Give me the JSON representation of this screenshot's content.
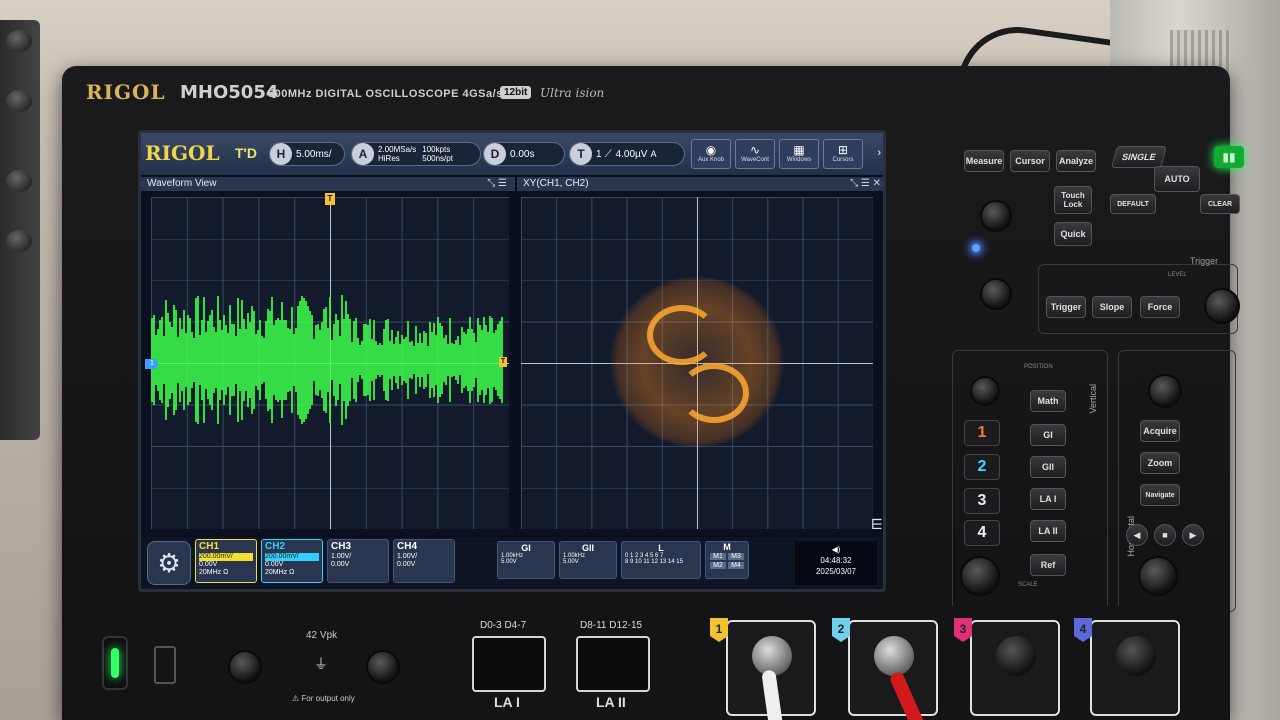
{
  "device": {
    "brand": "RIGOL",
    "model": "MHO5054",
    "spec": "500MHz DIGITAL OSCILLOSCOPE 4GSa/s",
    "bits": "12bit",
    "ultra": "Ultra ision"
  },
  "screen": {
    "logo": "RIGOL",
    "mode": "T'D",
    "horizontal": {
      "badge": "H",
      "value": "5.00ms/"
    },
    "acquire": {
      "badge": "A",
      "rate": "2.00MSa/s",
      "mode": "HiRes",
      "points": "100kpts",
      "per_div": "500ns/pt"
    },
    "delay": {
      "badge": "D",
      "value": "0.00s"
    },
    "trigger": {
      "badge": "T",
      "channel": "1",
      "level": "4.00µV",
      "suffix": "A"
    },
    "toolbar": [
      {
        "icon": "knob-icon",
        "label": "Aux Knob"
      },
      {
        "icon": "wave-icon",
        "label": "WaveCont"
      },
      {
        "icon": "window-icon",
        "label": "Windows"
      },
      {
        "icon": "cursor-icon",
        "label": "Cursors"
      }
    ],
    "waveform_view": {
      "title": "Waveform View"
    },
    "xy_view": {
      "title": "XY(CH1, CH2)"
    },
    "channels": [
      {
        "name": "CH1",
        "scale": "200.00mV/",
        "offset": "0.00V",
        "bw": "20MHz",
        "imp": "Ω",
        "color": "#f2e030"
      },
      {
        "name": "CH2",
        "scale": "200.00mV/",
        "offset": "0.00V",
        "bw": "20MHz",
        "imp": "Ω",
        "color": "#30d0ff"
      },
      {
        "name": "CH3",
        "scale": "1.00V/",
        "offset": "0.00V",
        "bw": "",
        "imp": "",
        "color": "#e060e0"
      },
      {
        "name": "CH4",
        "scale": "1.00V/",
        "offset": "0.00V",
        "bw": "",
        "imp": "",
        "color": "#5070ff"
      }
    ],
    "generators": [
      {
        "name": "GI",
        "freq": "1.00kHz",
        "amp": "5.00V"
      },
      {
        "name": "GII",
        "freq": "1.00kHz",
        "amp": "5.00V"
      }
    ],
    "logic": {
      "name": "L",
      "row1": "0 1 2 3   4 5 6 7",
      "row2": "8 9 10 11  12 13 14 15"
    },
    "math": {
      "name": "M",
      "items": [
        "M1",
        "M3",
        "M2",
        "M4"
      ]
    },
    "time": "04:48:32",
    "date": "2025/03/07",
    "marker_t": "T",
    "marker_ch": "1"
  },
  "panel": {
    "top_buttons": [
      "Measure",
      "Cursor",
      "Analyze"
    ],
    "run_buttons": [
      "SINGLE",
      "AUTO",
      "DEFAULT",
      "CLEAR"
    ],
    "touch_lock": "Touch Lock",
    "quick": "Quick",
    "trigger_label": "Trigger",
    "level_label": "LEVEL",
    "trigger_buttons": [
      "Trigger",
      "Slope",
      "Force"
    ],
    "position_label": "POSITION",
    "vertical_label": "Vertical",
    "horizontal_label": "Horizontal",
    "scale_label": "SCALE",
    "channel_keys": [
      "1",
      "2",
      "3",
      "4"
    ],
    "vert_buttons": [
      "Math",
      "GI",
      "GII",
      "LA I",
      "LA II",
      "Ref"
    ],
    "horiz_buttons": [
      "Acquire",
      "Zoom",
      "Navigate"
    ]
  },
  "front": {
    "vpk": "42 Vpk",
    "output_only": "For output only",
    "la1_top": "D0-3   D4-7",
    "la2_top": "D8-11  D12-15",
    "la1": "LA I",
    "la2": "LA II",
    "bnc": [
      {
        "num": "1",
        "color": "#f2c230"
      },
      {
        "num": "2",
        "color": "#6fd0ec"
      },
      {
        "num": "3",
        "color": "#e0307a"
      },
      {
        "num": "4",
        "color": "#5a6ad8"
      }
    ]
  }
}
